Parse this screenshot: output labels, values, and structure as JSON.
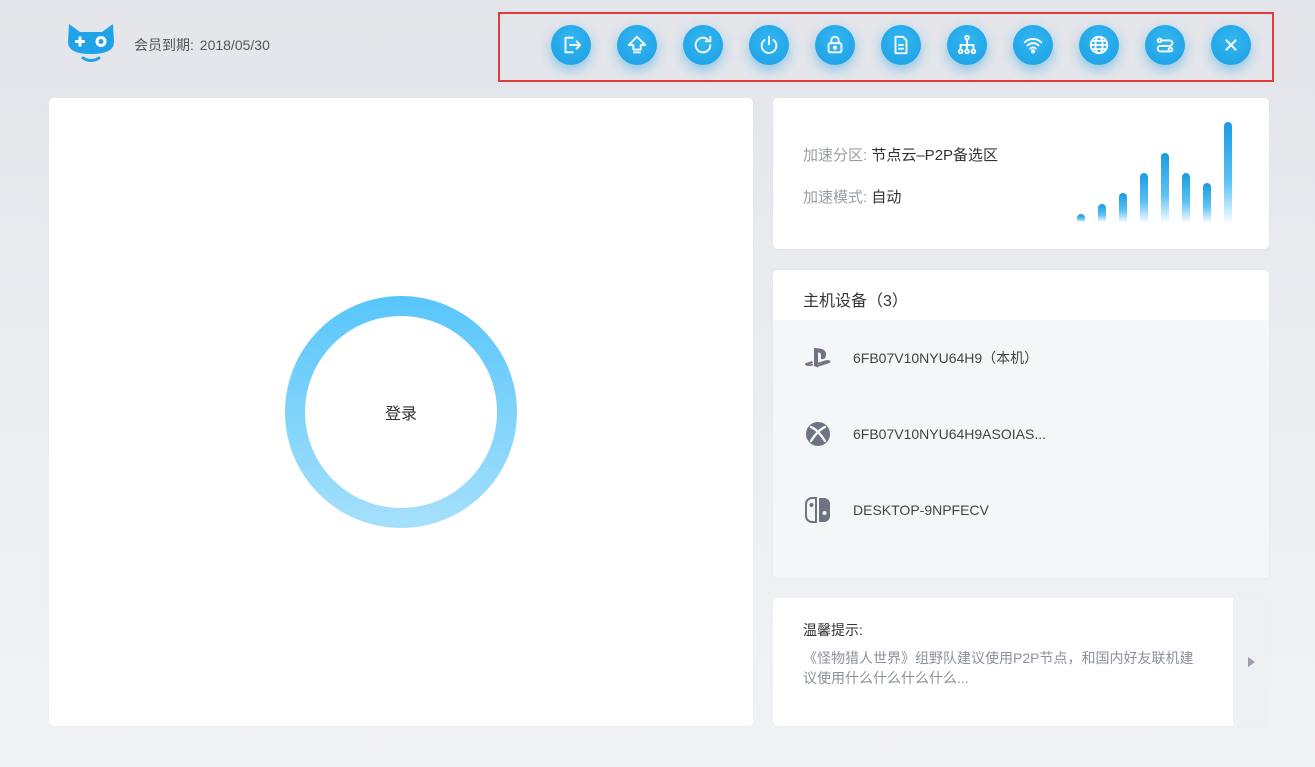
{
  "header": {
    "expiry_label": "会员到期:",
    "expiry_date": "2018/05/30"
  },
  "toolbar": {
    "buttons": [
      {
        "icon": "logout-icon"
      },
      {
        "icon": "upload-arrow-icon"
      },
      {
        "icon": "refresh-icon"
      },
      {
        "icon": "power-icon"
      },
      {
        "icon": "lock-icon"
      },
      {
        "icon": "document-icon"
      },
      {
        "icon": "network-tree-icon"
      },
      {
        "icon": "wifi-icon"
      },
      {
        "icon": "globe-icon"
      },
      {
        "icon": "route-icon"
      },
      {
        "icon": "close-icon"
      }
    ]
  },
  "main": {
    "login_label": "登录"
  },
  "speed": {
    "zone_label": "加速分区:",
    "zone_value": "节点云–P2P备选区",
    "mode_label": "加速模式:",
    "mode_value": "自动",
    "signal_levels": [
      0.08,
      0.18,
      0.28,
      0.48,
      0.68,
      0.48,
      0.38,
      0.98
    ]
  },
  "devices": {
    "title": "主机设备（3）",
    "items": [
      {
        "icon": "playstation-icon",
        "name": "6FB07V10NYU64H9（本机）"
      },
      {
        "icon": "xbox-icon",
        "name": "6FB07V10NYU64H9ASOIAS..."
      },
      {
        "icon": "nintendo-switch-icon",
        "name": "DESKTOP-9NPFECV"
      }
    ]
  },
  "tips": {
    "title": "温馨提示:",
    "text": "《怪物猎人世界》组野队建议使用P2P节点，和国内好友联机建议使用什么什么什么什么..."
  },
  "colors": {
    "accent": "#1b9ee3",
    "highlight_border": "#e23b3b",
    "ring_top": "#57c6fb",
    "ring_bottom": "#a6e0fb"
  }
}
